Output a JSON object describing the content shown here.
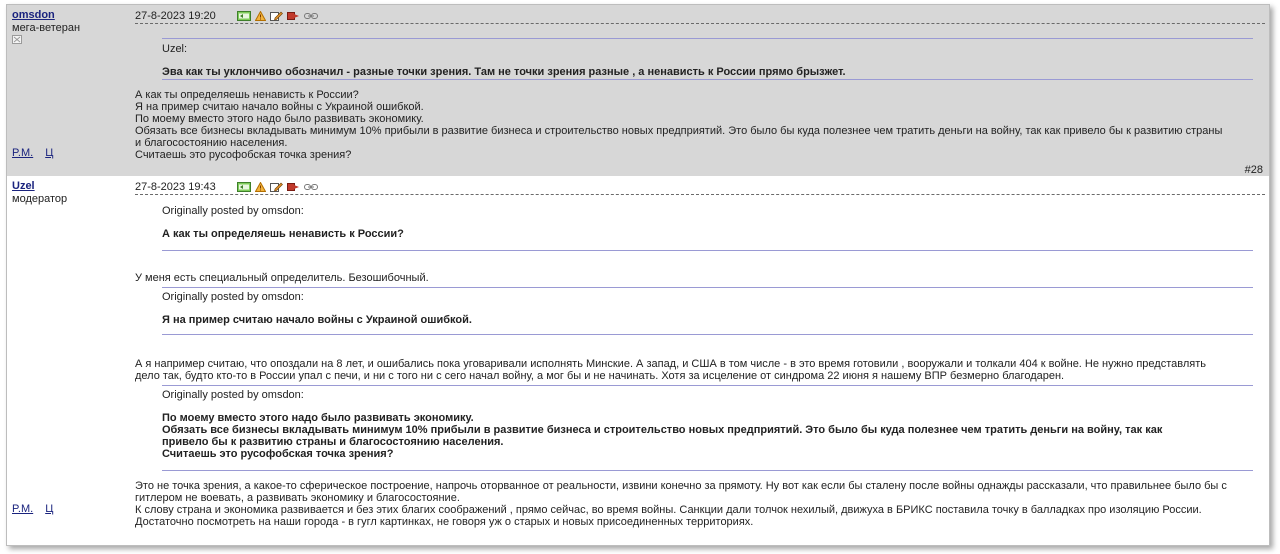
{
  "posts": [
    {
      "author": "omsdon",
      "rank": "мега-ветеран",
      "date": "27-8-2023 19:20",
      "pm": "P.M.",
      "ci": "Ц",
      "quote_author": "Uzel:",
      "quote_text": "Эва как ты уклончиво обозначил - разные точки зрения. Там не точки зрения разные , а ненависть к России прямо брызжет.",
      "message": [
        "А как ты определяешь ненависть к России?",
        "Я на пример считаю начало войны с Украиной ошибкой.",
        "По моему вместо этого надо было развивать экономику.",
        "Обязать все бизнесы вкладывать минимум 10% прибыли в развитие бизнеса и строительство новых предприятий. Это было бы куда полезнее чем тратить деньги на войну, так как привело бы к развитию страны",
        "и благосостоянию населения.",
        "Считаешь это русофобская точка зрения?"
      ],
      "post_number": "#28"
    },
    {
      "author": "Uzel",
      "rank": "модератор",
      "date": "27-8-2023 19:43",
      "pm": "P.M.",
      "ci": "Ц",
      "quote1_head": "Originally posted by omsdon:",
      "quote1_text": "А как ты определяешь ненависть к России?",
      "reply1": "У меня есть специальный определитель. Безошибочный.",
      "quote2_head": "Originally posted by omsdon:",
      "quote2_text": "Я на пример считаю начало войны с Украиной ошибкой.",
      "reply2": [
        "А я например считаю, что опоздали на 8 лет, и ошибались пока уговаривали исполнять Минские. А запад, и США в том числе - в это время готовили , вооружали и толкали 404 к войне. Не нужно представлять",
        "дело так, будто кто-то в России упал с печи, и ни с того ни с сего начал войну, а мог бы и не начинать. Хотя за исцеление от синдрома 22 июня я нашему ВПР безмерно благодарен."
      ],
      "quote3_head": "Originally posted by omsdon:",
      "quote3_text": [
        "По моему вместо этого надо было развивать экономику.",
        "Обязать все бизнесы вкладывать минимум 10% прибыли в развитие бизнеса и строительство новых предприятий. Это было бы куда полезнее чем тратить деньги на войну, так как",
        "привело бы к развитию страны и благосостоянию населения.",
        "Считаешь это русофобская точка зрения?"
      ],
      "reply3": [
        "Это не точка зрения, а какое-то сферическое построение, напрочь оторванное от реальности, извини конечно за прямоту. Ну вот как если бы сталену после войны однажды рассказали, что правильнее было бы с",
        "гитлером не воевать, а развивать экономику и благосостояние.",
        "К слову страна и экономика развивается и без этих благих соображений , прямо сейчас, во время войны. Санкции дали толчок нехилый, движуха в БРИКС поставила точку в балладках про изоляцию России.",
        "Достаточно посмотреть на наши города - в гугл картинках, не говоря уж о старых и новых присоединенных территориях."
      ]
    }
  ],
  "colors": {
    "odd_bg": "#d7d7d7",
    "link": "#1a237e",
    "quote_rule": "#9a9ad4"
  },
  "icons": [
    "reply-quote-icon",
    "report-warning-icon",
    "edit-icon",
    "forward-icon",
    "link-icon"
  ]
}
